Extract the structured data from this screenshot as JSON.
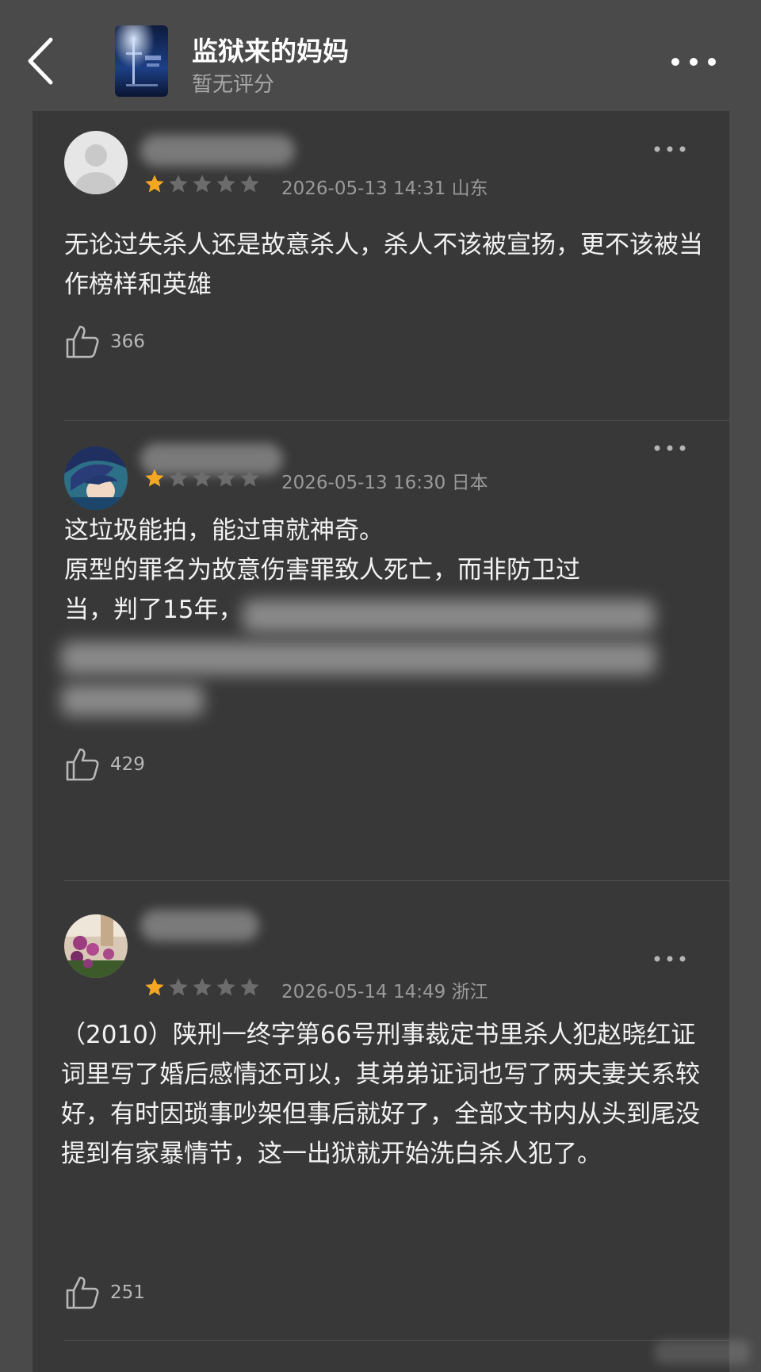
{
  "header": {
    "title": "监狱来的妈妈",
    "subtitle": "暂无评分"
  },
  "reviews": [
    {
      "rating": 1,
      "max_rating": 5,
      "date": "2026-05-13 14:31 山东",
      "text": "无论过失杀人还是故意杀人，杀人不该被宣扬，更不该被当作榜样和英雄",
      "likes": "366"
    },
    {
      "rating": 1,
      "max_rating": 5,
      "date": "2026-05-13 16:30 日本",
      "text_line1": "这垃圾能拍，能过审就神奇。",
      "text_line2": "原型的罪名为故意伤害罪致人死亡，而非防卫过",
      "text_line3": "当，判了15年，",
      "likes": "429"
    },
    {
      "rating": 1,
      "max_rating": 5,
      "date": "2026-05-14 14:49 浙江",
      "text": "（2010）陕刑一终字第66号刑事裁定书里杀人犯赵晓红证词里写了婚后感情还可以，其弟弟证词也写了两夫妻关系较好，有时因琐事吵架但事后就好了，全部文书内从头到尾没提到有家暴情节，这一出狱就开始洗白杀人犯了。",
      "likes": "251"
    }
  ],
  "colors": {
    "background": "#4a4a4a",
    "panel": "#383838",
    "star_active": "#f5a623",
    "star_inactive": "#6c6c6c"
  }
}
